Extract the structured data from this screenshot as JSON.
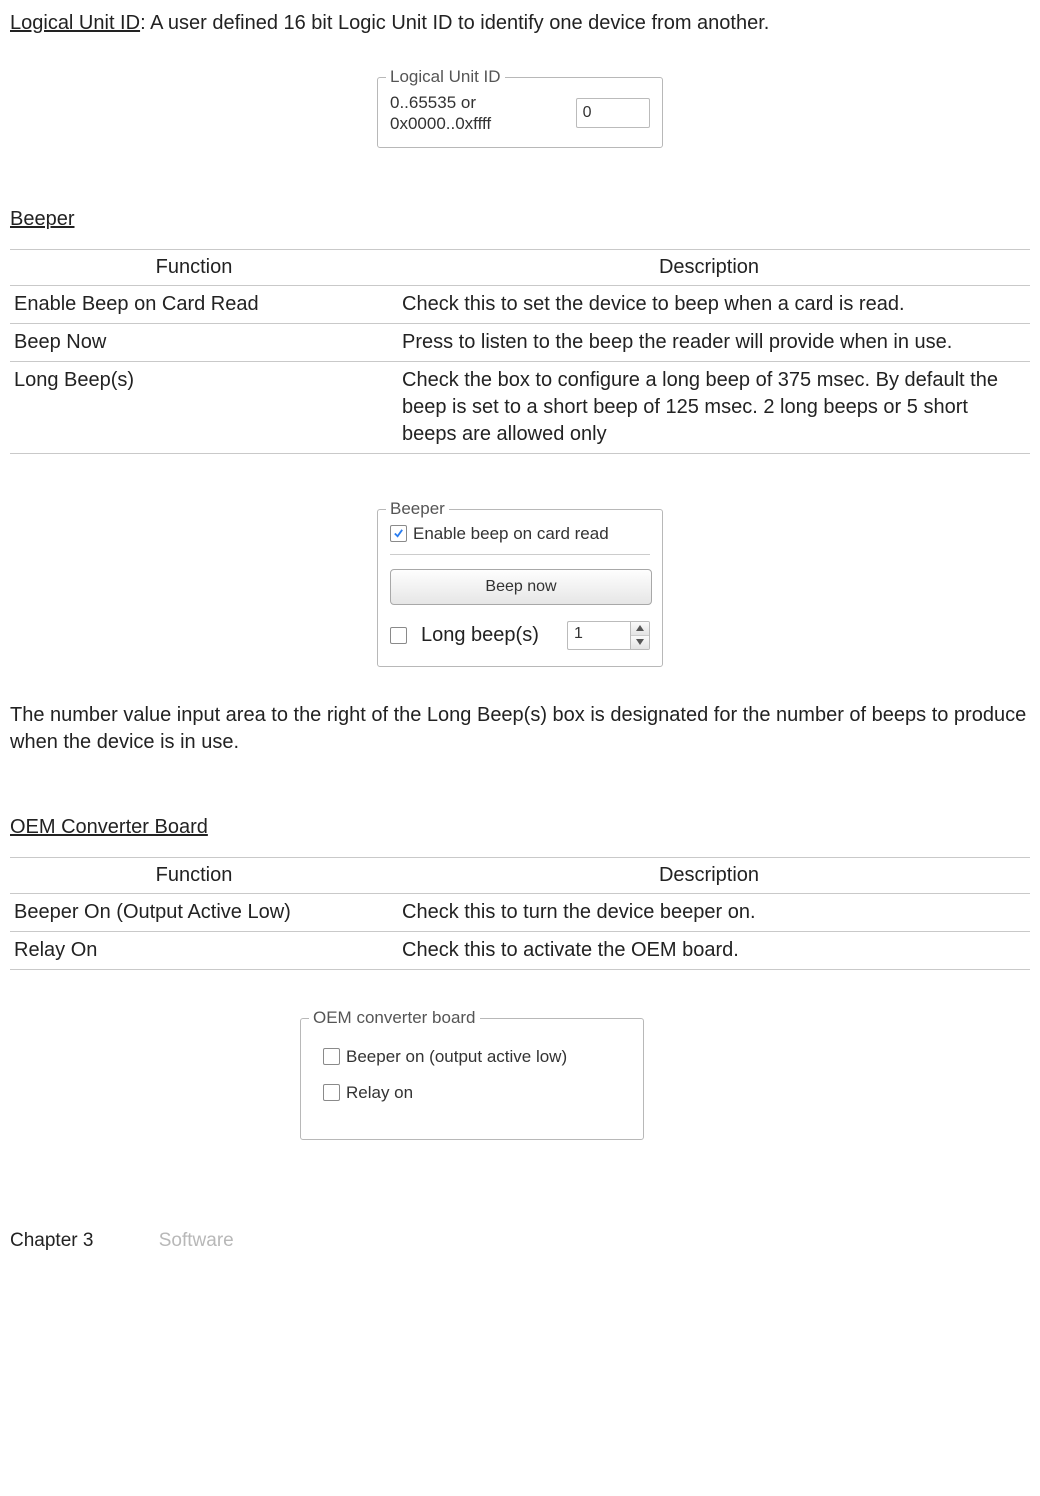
{
  "intro": {
    "label": "Logical Unit ID",
    "text": ": A user defined  16 bit Logic Unit ID to identify one device from another."
  },
  "logical_unit": {
    "legend": "Logical Unit ID",
    "range": "0..65535 or 0x0000..0xffff",
    "value": "0"
  },
  "beeper": {
    "heading": "Beeper",
    "table": {
      "headers": [
        "Function",
        "Description"
      ],
      "rows": [
        [
          "Enable Beep on Card Read",
          "Check this to set the device to beep when a card is read."
        ],
        [
          "Beep Now",
          "Press to listen to the beep the reader will provide when in use."
        ],
        [
          "Long Beep(s)",
          "Check the box to configure a long beep of 375 msec. By default the beep is set to a short beep of 125 msec. 2 long beeps or 5 short beeps are allowed only"
        ]
      ]
    },
    "panel": {
      "legend": "Beeper",
      "enable_label": "Enable beep on card read",
      "beep_now": "Beep now",
      "long_label": "Long beep(s)",
      "long_value": "1"
    },
    "note": "The number value input area to the right of the Long Beep(s) box is designated for the number of beeps to produce when the device is in use."
  },
  "oem": {
    "heading": "OEM Converter Board",
    "table": {
      "headers": [
        "Function",
        "Description"
      ],
      "rows": [
        [
          "Beeper On (Output Active Low)",
          "Check this to turn the device beeper on."
        ],
        [
          "Relay On",
          "Check this to activate the OEM board."
        ]
      ]
    },
    "panel": {
      "legend": "OEM converter board",
      "beeper_on": "Beeper on (output active low)",
      "relay_on": "Relay on"
    }
  },
  "footer": {
    "chapter": "Chapter 3",
    "section": "Software"
  }
}
